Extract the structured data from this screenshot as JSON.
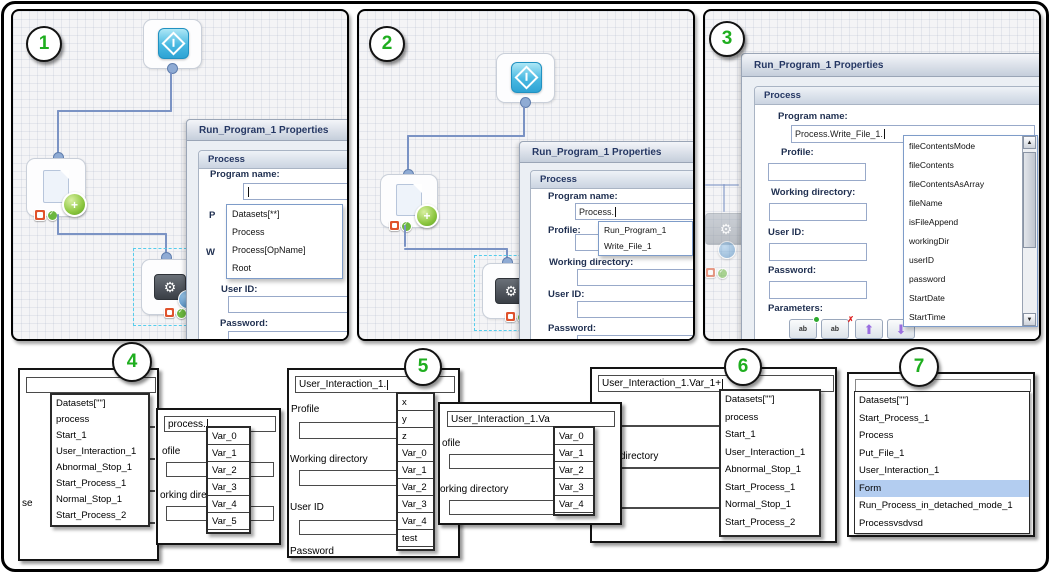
{
  "panel1": {
    "badge": "1",
    "props_title": "Run_Program_1 Properties",
    "section": "Process",
    "program_name_label": "Program name:",
    "profile_fragment": "P",
    "working_dir_fragment": "W",
    "user_id_label": "User ID:",
    "password_label": "Password:",
    "suggestions": [
      "Datasets[**]",
      "Process",
      "Process[OpName]",
      "Root"
    ]
  },
  "panel2": {
    "badge": "2",
    "props_title": "Run_Program_1 Properties",
    "section": "Process",
    "program_name_label": "Program name:",
    "program_name_value": "Process.",
    "profile_label": "Profile:",
    "working_dir_label": "Working directory:",
    "user_id_label": "User ID:",
    "password_label": "Password:",
    "suggestions": [
      "Run_Program_1",
      "Write_File_1"
    ]
  },
  "panel3": {
    "badge": "3",
    "props_title": "Run_Program_1 Properties",
    "section": "Process",
    "program_name_label": "Program name:",
    "program_name_value": "Process.Write_File_1.",
    "profile_label": "Profile:",
    "working_dir_label": "Working directory:",
    "user_id_label": "User ID:",
    "password_label": "Password:",
    "parameters_label": "Parameters:",
    "toolbar": {
      "add_icon_label": "ab",
      "delete_icon_label": "ab"
    },
    "suggestions": [
      "fileContentsMode",
      "fileContents",
      "fileContentsAsArray",
      "fileName",
      "isFileAppend",
      "workingDir",
      "userID",
      "password",
      "StartDate",
      "StartTime"
    ]
  },
  "panel4": {
    "badge": "4",
    "left_fragment": "se",
    "suggestions": [
      "Datasets[\"\"]",
      "process",
      "Start_1",
      "User_Interaction_1",
      "Abnormal_Stop_1",
      "Start_Process_1",
      "Normal_Stop_1",
      "Start_Process_2"
    ],
    "popup": {
      "input_value": "process.",
      "profile_fragment": "ofile",
      "working_dir_fragment": "orking dire",
      "suggestions": [
        "Var_0",
        "Var_1",
        "Var_2",
        "Var_3",
        "Var_4",
        "Var_5"
      ]
    }
  },
  "panel5": {
    "badge": "5",
    "input_value": "User_Interaction_1.",
    "profile_label": "Profile",
    "working_dir_label": "Working directory",
    "user_id_label": "User ID",
    "password_label": "Password",
    "suggestions": [
      "x",
      "y",
      "z",
      "Var_0",
      "Var_1",
      "Var_2",
      "Var_3",
      "Var_4",
      "test"
    ],
    "popup": {
      "input_value": "User_Interaction_1.Va",
      "profile_fragment": "ofile",
      "working_dir_fragment": "orking directory",
      "suggestions": [
        "Var_0",
        "Var_1",
        "Var_2",
        "Var_3",
        "Var_4"
      ]
    }
  },
  "panel6": {
    "badge": "6",
    "input_value": "User_Interaction_1.Var_1+",
    "working_dir_fragment": "directory",
    "suggestions": [
      "Datasets[\"\"]",
      "process",
      "Start_1",
      "User_Interaction_1",
      "Abnormal_Stop_1",
      "Start_Process_1",
      "Normal_Stop_1",
      "Start_Process_2"
    ]
  },
  "panel7": {
    "badge": "7",
    "suggestions": [
      "Datasets[\"\"]",
      "Start_Process_1",
      "Process",
      "Put_File_1",
      "User_Interaction_1",
      "Form",
      "Run_Process_in_detached_mode_1",
      "Processvsdvsd"
    ],
    "selected_index": 5
  },
  "colors": {
    "badge_green": "#1fae1f",
    "selection_blue": "#b3cdf0",
    "accent_cyan": "#35aede"
  }
}
